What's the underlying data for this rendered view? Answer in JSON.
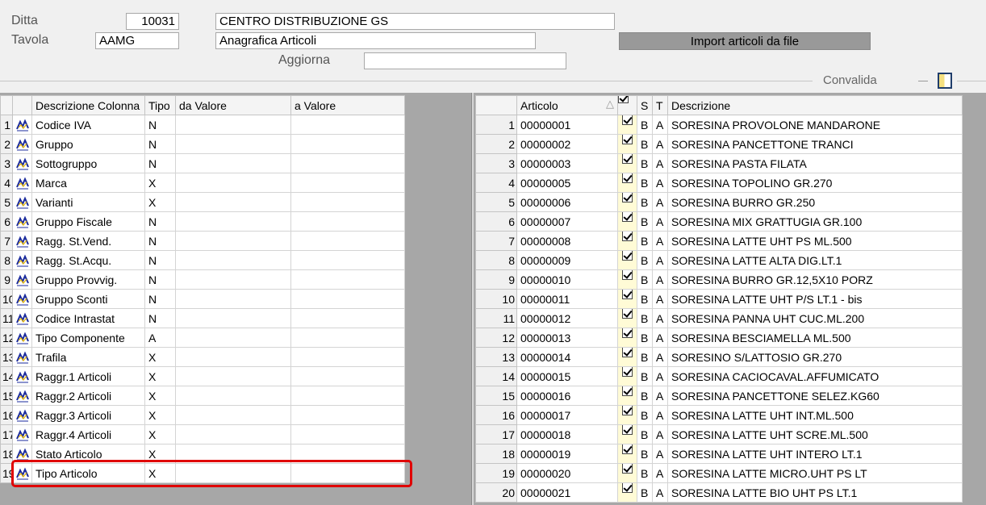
{
  "header": {
    "ditta_label": "Ditta",
    "ditta_code": "10031",
    "ditta_name": "CENTRO DISTRIBUZIONE GS",
    "tavola_label": "Tavola",
    "tavola_code": "AAMG",
    "tavola_name": "Anagrafica Articoli",
    "import_button": "Import articoli da file",
    "aggiorna_label": "Aggiorna",
    "aggiorna_value": "",
    "convalida_label": "Convalida"
  },
  "left_grid": {
    "columns": [
      "Descrizione Colonna",
      "Tipo",
      "da Valore",
      "a Valore"
    ],
    "rows": [
      {
        "n": "1",
        "desc": "Codice IVA",
        "tipo": "N",
        "da": "",
        "a": ""
      },
      {
        "n": "2",
        "desc": "Gruppo",
        "tipo": "N",
        "da": "",
        "a": ""
      },
      {
        "n": "3",
        "desc": "Sottogruppo",
        "tipo": "N",
        "da": "",
        "a": ""
      },
      {
        "n": "4",
        "desc": "Marca",
        "tipo": "X",
        "da": "",
        "a": ""
      },
      {
        "n": "5",
        "desc": "Varianti",
        "tipo": "X",
        "da": "",
        "a": ""
      },
      {
        "n": "6",
        "desc": "Gruppo Fiscale",
        "tipo": "N",
        "da": "",
        "a": ""
      },
      {
        "n": "7",
        "desc": "Ragg.  St.Vend.",
        "tipo": "N",
        "da": "",
        "a": ""
      },
      {
        "n": "8",
        "desc": "Ragg.  St.Acqu.",
        "tipo": "N",
        "da": "",
        "a": ""
      },
      {
        "n": "9",
        "desc": "Gruppo Provvig.",
        "tipo": "N",
        "da": "",
        "a": ""
      },
      {
        "n": "10",
        "desc": "Gruppo Sconti",
        "tipo": "N",
        "da": "",
        "a": ""
      },
      {
        "n": "11",
        "desc": "Codice Intrastat",
        "tipo": "N",
        "da": "",
        "a": ""
      },
      {
        "n": "12",
        "desc": "Tipo Componente",
        "tipo": "A",
        "da": "",
        "a": ""
      },
      {
        "n": "13",
        "desc": "Trafila",
        "tipo": "X",
        "da": "",
        "a": ""
      },
      {
        "n": "14",
        "desc": "Raggr.1 Articoli",
        "tipo": "X",
        "da": "",
        "a": ""
      },
      {
        "n": "15",
        "desc": "Raggr.2 Articoli",
        "tipo": "X",
        "da": "",
        "a": ""
      },
      {
        "n": "16",
        "desc": "Raggr.3 Articoli",
        "tipo": "X",
        "da": "",
        "a": ""
      },
      {
        "n": "17",
        "desc": "Raggr.4 Articoli",
        "tipo": "X",
        "da": "",
        "a": ""
      },
      {
        "n": "18",
        "desc": "Stato Articolo",
        "tipo": "X",
        "da": "",
        "a": ""
      },
      {
        "n": "19",
        "desc": "Tipo  Articolo",
        "tipo": "X",
        "da": "",
        "a": ""
      }
    ]
  },
  "right_grid": {
    "columns": [
      "Articolo",
      "",
      "S",
      "T",
      "Descrizione"
    ],
    "sort_indicator": "△",
    "rows": [
      {
        "n": "1",
        "art": "00000001",
        "s": "B",
        "t": "A",
        "desc": "SORESINA PROVOLONE MANDARONE"
      },
      {
        "n": "2",
        "art": "00000002",
        "s": "B",
        "t": "A",
        "desc": "SORESINA PANCETTONE TRANCI"
      },
      {
        "n": "3",
        "art": "00000003",
        "s": "B",
        "t": "A",
        "desc": "SORESINA PASTA FILATA"
      },
      {
        "n": "4",
        "art": "00000005",
        "s": "B",
        "t": "A",
        "desc": "SORESINA TOPOLINO GR.270"
      },
      {
        "n": "5",
        "art": "00000006",
        "s": "B",
        "t": "A",
        "desc": "SORESINA BURRO GR.250"
      },
      {
        "n": "6",
        "art": "00000007",
        "s": "B",
        "t": "A",
        "desc": "SORESINA MIX GRATTUGIA GR.100"
      },
      {
        "n": "7",
        "art": "00000008",
        "s": "B",
        "t": "A",
        "desc": "SORESINA LATTE UHT PS ML.500"
      },
      {
        "n": "8",
        "art": "00000009",
        "s": "B",
        "t": "A",
        "desc": "SORESINA LATTE ALTA DIG.LT.1"
      },
      {
        "n": "9",
        "art": "00000010",
        "s": "B",
        "t": "A",
        "desc": "SORESINA BURRO GR.12,5X10 PORZ"
      },
      {
        "n": "10",
        "art": "00000011",
        "s": "B",
        "t": "A",
        "desc": "SORESINA LATTE UHT P/S LT.1 - bis"
      },
      {
        "n": "11",
        "art": "00000012",
        "s": "B",
        "t": "A",
        "desc": "SORESINA PANNA UHT CUC.ML.200"
      },
      {
        "n": "12",
        "art": "00000013",
        "s": "B",
        "t": "A",
        "desc": "SORESINA BESCIAMELLA ML.500"
      },
      {
        "n": "13",
        "art": "00000014",
        "s": "B",
        "t": "A",
        "desc": "SORESINO S/LATTOSIO GR.270"
      },
      {
        "n": "14",
        "art": "00000015",
        "s": "B",
        "t": "A",
        "desc": "SORESINA CACIOCAVAL.AFFUMICATO"
      },
      {
        "n": "15",
        "art": "00000016",
        "s": "B",
        "t": "A",
        "desc": "SORESINA PANCETTONE SELEZ.KG60"
      },
      {
        "n": "16",
        "art": "00000017",
        "s": "B",
        "t": "A",
        "desc": "SORESINA LATTE UHT INT.ML.500"
      },
      {
        "n": "17",
        "art": "00000018",
        "s": "B",
        "t": "A",
        "desc": "SORESINA LATTE UHT SCRE.ML.500"
      },
      {
        "n": "18",
        "art": "00000019",
        "s": "B",
        "t": "A",
        "desc": "SORESINA LATTE UHT INTERO LT.1"
      },
      {
        "n": "19",
        "art": "00000020",
        "s": "B",
        "t": "A",
        "desc": "SORESINA LATTE MICRO.UHT PS LT"
      },
      {
        "n": "20",
        "art": "00000021",
        "s": "B",
        "t": "A",
        "desc": "SORESINA LATTE BIO UHT PS LT.1"
      }
    ]
  },
  "colors": {
    "highlight": "#e00000",
    "check_column_bg": "#fffbd6",
    "import_button_bg": "#999999"
  }
}
